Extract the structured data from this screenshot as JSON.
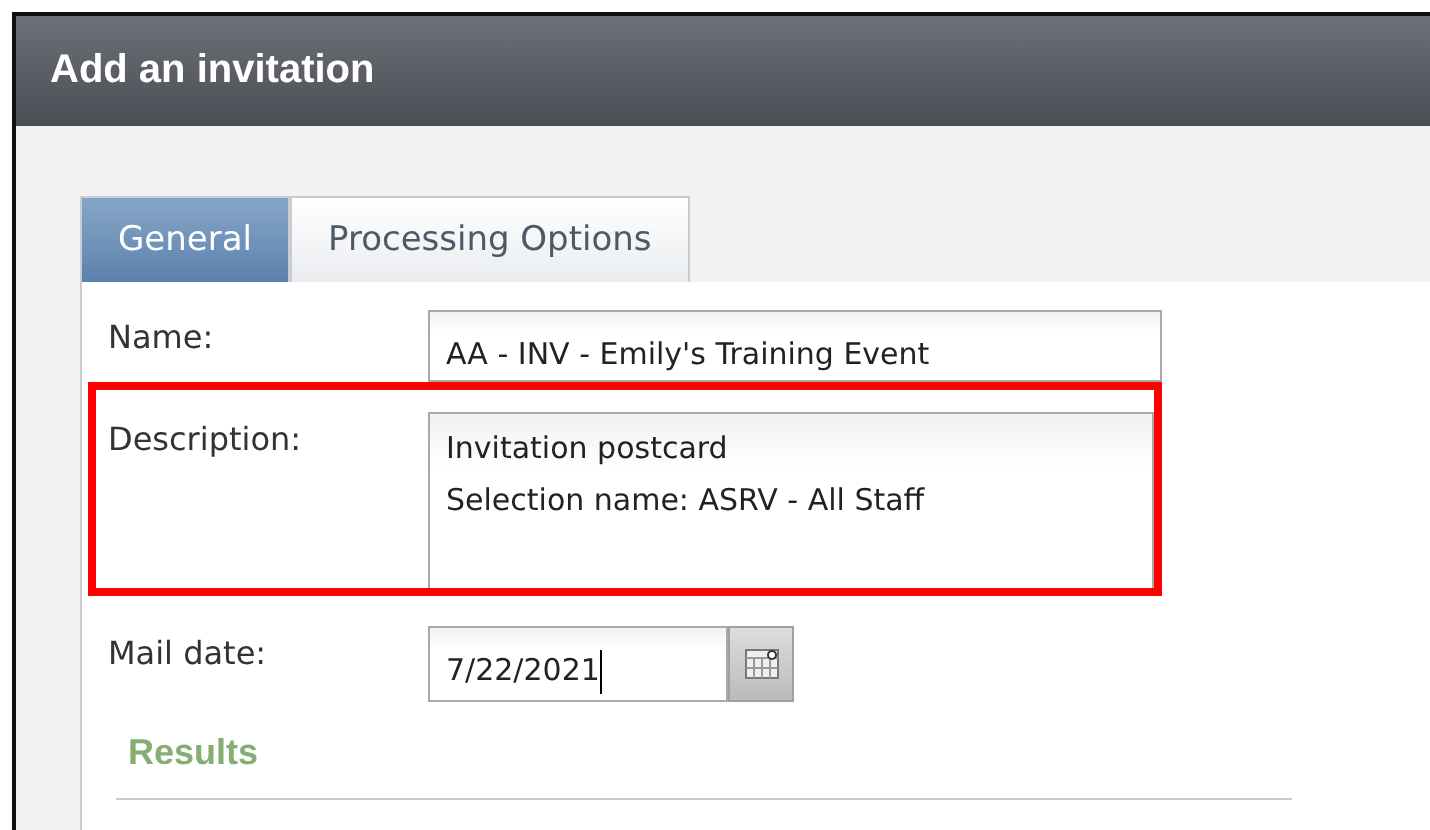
{
  "window": {
    "title": "Add an invitation"
  },
  "tabs": [
    {
      "label": "General",
      "selected": true
    },
    {
      "label": "Processing Options",
      "selected": false
    }
  ],
  "fields": [
    {
      "kind": "text",
      "label": "Name:",
      "value": "AA - INV - Emily's Training Event",
      "highlighted": false
    },
    {
      "kind": "multiline",
      "label": "Description:",
      "lines": [
        "Invitation postcard",
        "Selection name: ASRV - All Staff"
      ],
      "highlighted": true
    },
    {
      "kind": "date",
      "label": "Mail date:",
      "value": "7/22/2021",
      "highlighted": false
    }
  ],
  "section": {
    "title": "Results"
  }
}
